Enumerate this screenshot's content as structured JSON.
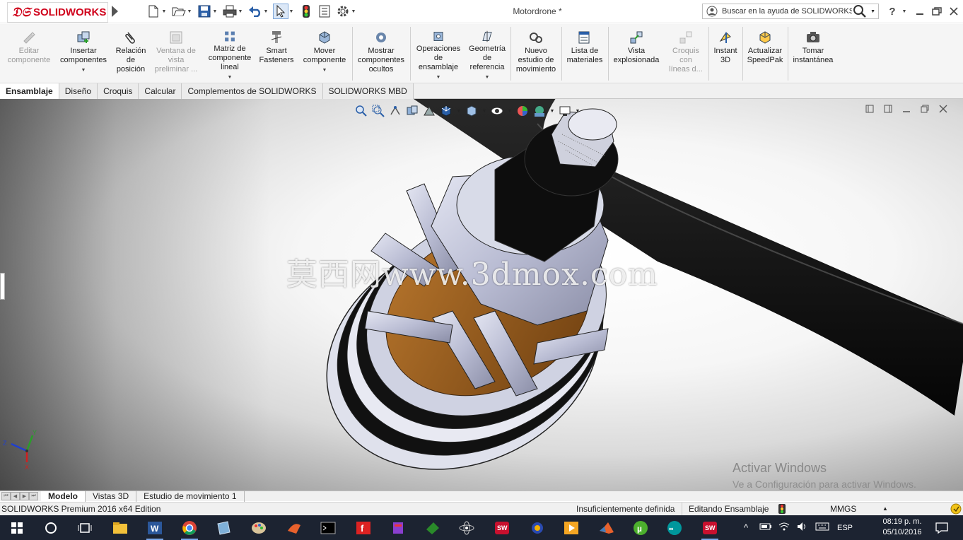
{
  "app": {
    "brand": "SOLIDWORKS",
    "document_title": "Motordrone *",
    "search_placeholder": "Buscar en la ayuda de SOLIDWORKS"
  },
  "quick_access": [
    {
      "icon": "new-document-icon"
    },
    {
      "icon": "open-folder-icon"
    },
    {
      "icon": "save-icon"
    },
    {
      "icon": "print-icon"
    },
    {
      "icon": "undo-icon"
    },
    {
      "icon": "select-cursor-icon"
    },
    {
      "icon": "rebuild-traffic-light-icon"
    },
    {
      "icon": "file-properties-icon"
    },
    {
      "icon": "options-gear-icon"
    }
  ],
  "commands": [
    {
      "label": "Editar\ncomponente",
      "enabled": false,
      "icon": "edit-component-icon"
    },
    {
      "label": "Insertar\ncomponentes",
      "enabled": true,
      "icon": "insert-components-icon",
      "dropdown": true
    },
    {
      "label": "Relación\nde\nposición",
      "enabled": true,
      "icon": "mate-paperclip-icon"
    },
    {
      "label": "Ventana de\nvista\npreliminar ...",
      "enabled": false,
      "icon": "preview-window-icon"
    },
    {
      "label": "Matriz de\ncomponente\nlineal",
      "enabled": true,
      "icon": "linear-pattern-icon",
      "dropdown": true
    },
    {
      "label": "Smart\nFasteners",
      "enabled": true,
      "icon": "smart-fasteners-icon"
    },
    {
      "label": "Mover\ncomponente",
      "enabled": true,
      "icon": "move-component-icon",
      "dropdown": true
    },
    {
      "label": "Mostrar\ncomponentes\nocultos",
      "enabled": true,
      "icon": "show-hidden-icon"
    },
    {
      "label": "Operaciones\nde\nensamblaje",
      "enabled": true,
      "icon": "assembly-features-icon",
      "dropdown": true
    },
    {
      "label": "Geometría\nde\nreferencia",
      "enabled": true,
      "icon": "reference-geometry-icon",
      "dropdown": true
    },
    {
      "label": "Nuevo\nestudio de\nmovimiento",
      "enabled": true,
      "icon": "motion-study-icon"
    },
    {
      "label": "Lista de\nmateriales",
      "enabled": true,
      "icon": "bill-of-materials-icon"
    },
    {
      "label": "Vista\nexplosionada",
      "enabled": true,
      "icon": "exploded-view-icon"
    },
    {
      "label": "Croquis\ncon\nlíneas d...",
      "enabled": false,
      "icon": "explode-line-sketch-icon"
    },
    {
      "label": "Instant\n3D",
      "enabled": true,
      "icon": "instant-3d-icon"
    },
    {
      "label": "Actualizar\nSpeedPak",
      "enabled": true,
      "icon": "speedpak-icon"
    },
    {
      "label": "Tomar\ninstantánea",
      "enabled": true,
      "icon": "camera-snapshot-icon"
    }
  ],
  "tabs": [
    "Ensamblaje",
    "Diseño",
    "Croquis",
    "Calcular",
    "Complementos de SOLIDWORKS",
    "SOLIDWORKS MBD"
  ],
  "active_tab": "Ensamblaje",
  "watermark": "莫西网www.3dmox.com",
  "activation": {
    "title": "Activar Windows",
    "subtitle": "Ve a Configuración para activar Windows."
  },
  "triad": {
    "x": "X",
    "y": "Y",
    "z": "Z"
  },
  "bottom_tabs": [
    "Modelo",
    "Vistas 3D",
    "Estudio de movimiento 1"
  ],
  "active_bottom_tab": "Modelo",
  "status": {
    "edition": "SOLIDWORKS Premium 2016 x64 Edition",
    "definition": "Insuficientemente definida",
    "mode": "Editando Ensamblaje",
    "units": "MMGS"
  },
  "taskbar": {
    "language": "ESP",
    "time": "08:19 p. m.",
    "date": "05/10/2016"
  },
  "colors": {
    "brand_red": "#d0021b",
    "taskbar": "#1c2331",
    "accent_blue": "#1f6fd0"
  }
}
